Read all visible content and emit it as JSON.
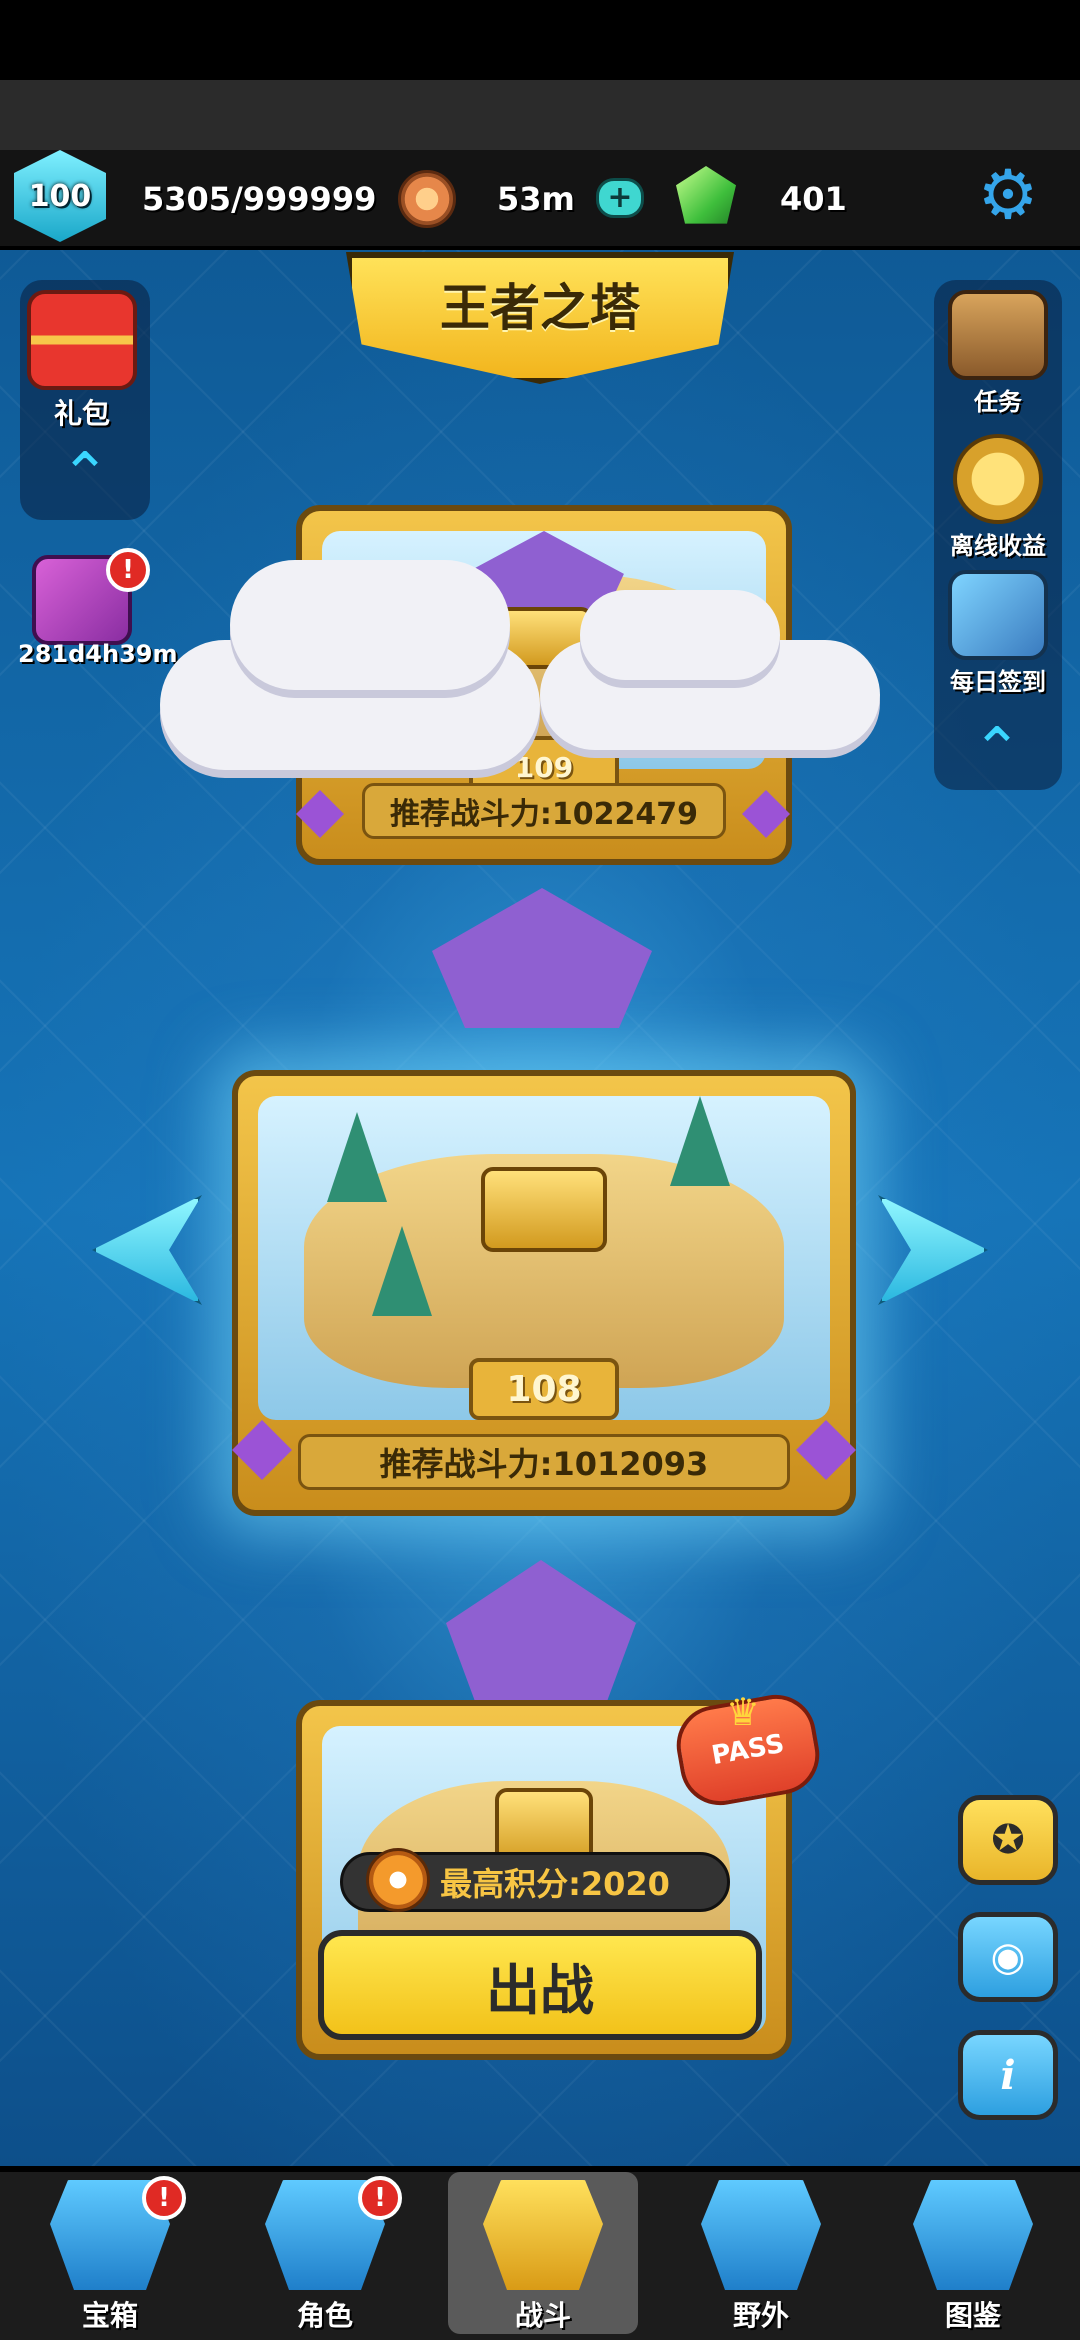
{
  "header": {
    "level": "100",
    "exp": "5305/999999",
    "coins": "53m",
    "gems": "401"
  },
  "title": "王者之塔",
  "left_panel": {
    "gift_label": "礼包",
    "event_timer": "281d4h39m",
    "badge": "!"
  },
  "right_panel": {
    "items": [
      "任务",
      "离线收益",
      "每日签到"
    ]
  },
  "stages": {
    "upper": {
      "number": "109",
      "power": "推荐战斗力:1022479"
    },
    "current": {
      "number": "108",
      "power": "推荐战斗力:1012093"
    },
    "lower": {
      "score": "最高积分:2020",
      "pass": "PASS",
      "fight": "出战"
    }
  },
  "nav": {
    "items": [
      "宝箱",
      "角色",
      "战斗",
      "野外",
      "图鉴"
    ],
    "badge": "!"
  },
  "colors": {
    "accent_blue": "#35a5ea",
    "gold": "#f2c21a",
    "dark": "#2b2b2b"
  }
}
